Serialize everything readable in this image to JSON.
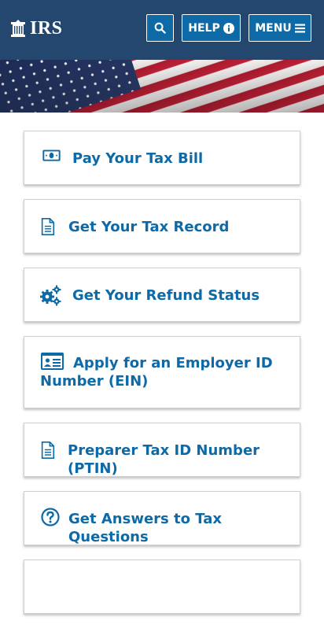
{
  "header": {
    "logo_text": "IRS",
    "search_icon": "search-icon",
    "help_label": "HELP",
    "help_icon": "info-circle-icon",
    "menu_label": "MENU",
    "menu_icon": "hamburger-icon",
    "background_color": "#23476e",
    "button_color": "#0e6aa6"
  },
  "banner": {
    "description": "american-flag"
  },
  "cards": [
    {
      "label": "Pay Your Tax Bill",
      "icon": "money-bill-icon"
    },
    {
      "label": "Get Your Tax Record",
      "icon": "document-icon"
    },
    {
      "label": "Get Your Refund Status",
      "icon": "cogs-icon"
    },
    {
      "label": "Apply for an Employer ID Number (EIN)",
      "icon": "id-card-icon"
    },
    {
      "label": "Preparer Tax ID Number (PTIN)",
      "icon": "document-icon"
    },
    {
      "label": "Get Answers to Tax Questions",
      "icon": "question-circle-icon"
    }
  ],
  "accent_color": "#0e6aa6"
}
